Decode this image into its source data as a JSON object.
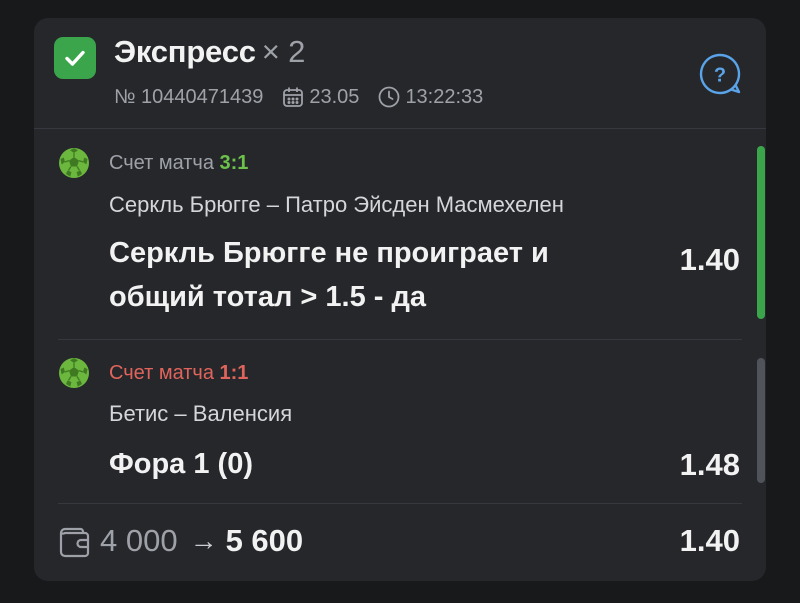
{
  "colors": {
    "background": "#18191b",
    "card": "#25272b",
    "win_green": "#3aa54a",
    "score_win": "#6cc24a",
    "score_lose": "#e0645c",
    "accent_blue": "#5aa3e8",
    "text_muted": "#9ea2a8"
  },
  "header": {
    "title": "Экспресс",
    "count": "× 2",
    "bet_number": "№ 10440471439",
    "date": "23.05",
    "time": "13:22:33",
    "icons": [
      "check-icon",
      "calendar-icon",
      "clock-icon",
      "help-icon"
    ]
  },
  "bets": [
    {
      "score_label": "Счет матча",
      "score": "3:1",
      "status": "win",
      "teams": "Серкль Брюгге – Патро Эйсден Масмехелен",
      "outcome_line1": "Серкль Брюгге не проиграет и",
      "outcome_line2": "общий тотал > 1.5 - да",
      "odds": "1.40"
    },
    {
      "score_label": "Счет матча",
      "score": "1:1",
      "status": "lose",
      "teams": "Бетис – Валенсия",
      "outcome_line1": "Фора 1 (0)",
      "odds": "1.48"
    }
  ],
  "footer": {
    "stake": "4 000",
    "arrow": "→",
    "payout": "5 600",
    "total_odds": "1.40"
  }
}
